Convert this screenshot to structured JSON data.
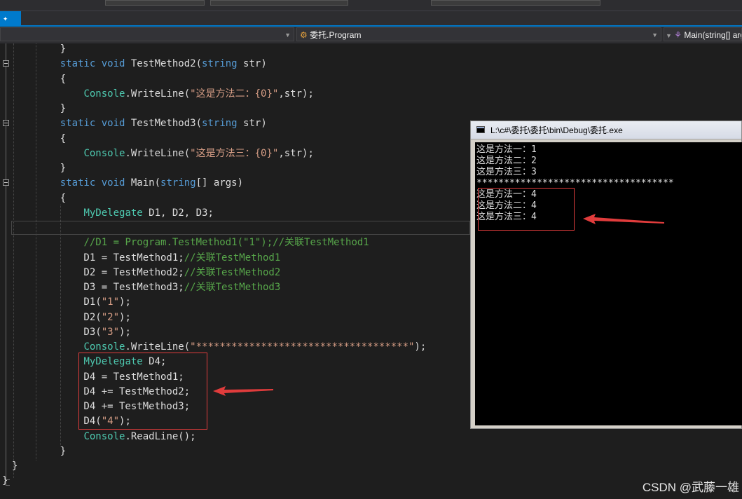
{
  "navbar": {
    "class_name": "委托.Program",
    "member_name": "Main(string[] args)"
  },
  "editor": {
    "lines": [
      [
        {
          "t": "    }",
          "c": ""
        }
      ],
      [
        {
          "t": "    ",
          "c": ""
        },
        {
          "t": "static",
          "c": "kw"
        },
        {
          "t": " ",
          "c": ""
        },
        {
          "t": "void",
          "c": "kw"
        },
        {
          "t": " TestMethod2(",
          "c": ""
        },
        {
          "t": "string",
          "c": "kw"
        },
        {
          "t": " str)",
          "c": ""
        }
      ],
      [
        {
          "t": "    {",
          "c": ""
        }
      ],
      [
        {
          "t": "        ",
          "c": ""
        },
        {
          "t": "Console",
          "c": "ty"
        },
        {
          "t": ".WriteLine(",
          "c": ""
        },
        {
          "t": "\"这是方法二：{0}\"",
          "c": "st"
        },
        {
          "t": ",str);",
          "c": ""
        }
      ],
      [
        {
          "t": "    }",
          "c": ""
        }
      ],
      [
        {
          "t": "    ",
          "c": ""
        },
        {
          "t": "static",
          "c": "kw"
        },
        {
          "t": " ",
          "c": ""
        },
        {
          "t": "void",
          "c": "kw"
        },
        {
          "t": " TestMethod3(",
          "c": ""
        },
        {
          "t": "string",
          "c": "kw"
        },
        {
          "t": " str)",
          "c": ""
        }
      ],
      [
        {
          "t": "    {",
          "c": ""
        }
      ],
      [
        {
          "t": "        ",
          "c": ""
        },
        {
          "t": "Console",
          "c": "ty"
        },
        {
          "t": ".WriteLine(",
          "c": ""
        },
        {
          "t": "\"这是方法三：{0}\"",
          "c": "st"
        },
        {
          "t": ",str);",
          "c": ""
        }
      ],
      [
        {
          "t": "    }",
          "c": ""
        }
      ],
      [
        {
          "t": "    ",
          "c": ""
        },
        {
          "t": "static",
          "c": "kw"
        },
        {
          "t": " ",
          "c": ""
        },
        {
          "t": "void",
          "c": "kw"
        },
        {
          "t": " Main(",
          "c": ""
        },
        {
          "t": "string",
          "c": "kw"
        },
        {
          "t": "[] args)",
          "c": ""
        }
      ],
      [
        {
          "t": "    {",
          "c": ""
        }
      ],
      [
        {
          "t": "        ",
          "c": ""
        },
        {
          "t": "MyDelegate",
          "c": "ty"
        },
        {
          "t": " D1, D2, D3;",
          "c": ""
        }
      ],
      [
        {
          "t": "",
          "c": ""
        }
      ],
      [
        {
          "t": "        ",
          "c": ""
        },
        {
          "t": "//D1 = Program.TestMethod1(\"1\");//关联TestMethod1",
          "c": "cm"
        }
      ],
      [
        {
          "t": "        D1 = TestMethod1;",
          "c": ""
        },
        {
          "t": "//关联TestMethod1",
          "c": "cm"
        }
      ],
      [
        {
          "t": "        D2 = TestMethod2;",
          "c": ""
        },
        {
          "t": "//关联TestMethod2",
          "c": "cm"
        }
      ],
      [
        {
          "t": "        D3 = TestMethod3;",
          "c": ""
        },
        {
          "t": "//关联TestMethod3",
          "c": "cm"
        }
      ],
      [
        {
          "t": "        D1(",
          "c": ""
        },
        {
          "t": "\"1\"",
          "c": "st"
        },
        {
          "t": ");",
          "c": ""
        }
      ],
      [
        {
          "t": "        D2(",
          "c": ""
        },
        {
          "t": "\"2\"",
          "c": "st"
        },
        {
          "t": ");",
          "c": ""
        }
      ],
      [
        {
          "t": "        D3(",
          "c": ""
        },
        {
          "t": "\"3\"",
          "c": "st"
        },
        {
          "t": ");",
          "c": ""
        }
      ],
      [
        {
          "t": "        ",
          "c": ""
        },
        {
          "t": "Console",
          "c": "ty"
        },
        {
          "t": ".WriteLine(",
          "c": ""
        },
        {
          "t": "\"************************************\"",
          "c": "st"
        },
        {
          "t": ");",
          "c": ""
        }
      ],
      [
        {
          "t": "        ",
          "c": ""
        },
        {
          "t": "MyDelegate",
          "c": "ty"
        },
        {
          "t": " D4;",
          "c": ""
        }
      ],
      [
        {
          "t": "        D4 = TestMethod1;",
          "c": ""
        }
      ],
      [
        {
          "t": "        D4 += TestMethod2;",
          "c": ""
        }
      ],
      [
        {
          "t": "        D4 += TestMethod3;",
          "c": ""
        }
      ],
      [
        {
          "t": "        D4(",
          "c": ""
        },
        {
          "t": "\"4\"",
          "c": "st"
        },
        {
          "t": ");",
          "c": ""
        }
      ],
      [
        {
          "t": "        ",
          "c": ""
        },
        {
          "t": "Console",
          "c": "ty"
        },
        {
          "t": ".ReadLine();",
          "c": ""
        }
      ],
      [
        {
          "t": "    }",
          "c": ""
        }
      ],
      [
        {
          "t": "}",
          "c": ""
        }
      ],
      [
        {
          "t": "}",
          "c": ""
        }
      ]
    ]
  },
  "console": {
    "title": "L:\\c#\\委托\\委托\\bin\\Debug\\委托.exe",
    "lines": [
      "这是方法一：1",
      "这是方法二：2",
      "这是方法三：3",
      "************************************",
      "这是方法一：4",
      "这是方法二：4",
      "这是方法三：4"
    ]
  },
  "watermark": "CSDN @武藤一雄",
  "colors": {
    "keyword": "#569cd6",
    "type": "#4ec9b0",
    "string": "#d69d85",
    "comment": "#57a64a",
    "highlight_box": "#e03c3c",
    "arrow": "#e03c3c"
  }
}
